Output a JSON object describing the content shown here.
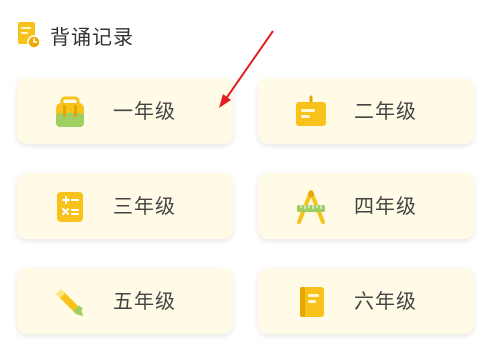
{
  "header": {
    "title": "背诵记录",
    "icon": "record-clock-icon"
  },
  "grades": [
    {
      "label": "一年级",
      "icon": "backpack-icon"
    },
    {
      "label": "二年级",
      "icon": "easel-board-icon"
    },
    {
      "label": "三年级",
      "icon": "calculator-icon"
    },
    {
      "label": "四年级",
      "icon": "compass-ruler-icon"
    },
    {
      "label": "五年级",
      "icon": "pencil-icon"
    },
    {
      "label": "六年级",
      "icon": "book-icon"
    }
  ],
  "colors": {
    "card_background": "#fffbe6",
    "icon_yellow": "#f7c21a",
    "icon_green": "#9fce62",
    "annotation_arrow": "#e02020"
  }
}
